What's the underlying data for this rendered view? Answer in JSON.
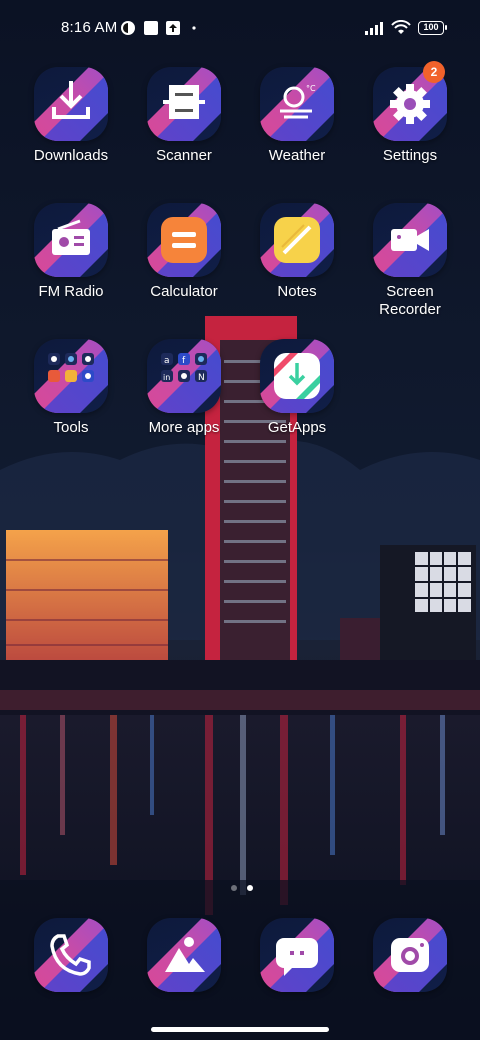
{
  "status_bar": {
    "time": "8:16 AM",
    "battery": "100",
    "icons": [
      "notification-app-icon",
      "image-notification-icon",
      "upload-notification-icon",
      "dot-icon",
      "signal-icon",
      "wifi-icon",
      "battery-icon"
    ]
  },
  "apps": [
    {
      "label": "Downloads",
      "icon": "download-icon"
    },
    {
      "label": "Scanner",
      "icon": "scanner-icon"
    },
    {
      "label": "Weather",
      "icon": "weather-icon"
    },
    {
      "label": "Settings",
      "icon": "gear-icon",
      "badge": "2"
    },
    {
      "label": "FM Radio",
      "icon": "radio-icon"
    },
    {
      "label": "Calculator",
      "icon": "calculator-icon"
    },
    {
      "label": "Notes",
      "icon": "notes-icon"
    },
    {
      "label": "Screen\nRecorder",
      "icon": "video-camera-icon"
    },
    {
      "label": "Tools",
      "icon": "folder-icon"
    },
    {
      "label": "More apps",
      "icon": "folder-icon"
    },
    {
      "label": "GetApps",
      "icon": "getapps-icon"
    }
  ],
  "dock": [
    {
      "icon": "phone-icon"
    },
    {
      "icon": "gallery-icon"
    },
    {
      "icon": "messages-icon"
    },
    {
      "icon": "camera-icon"
    }
  ],
  "page_indicator": {
    "pages": 2,
    "current": 2
  },
  "colors": {
    "accent": "#f1622b",
    "tile_bg": "#0e1a3c",
    "stripe_pink": "#e0468f",
    "stripe_purple": "#8a4fd8"
  }
}
